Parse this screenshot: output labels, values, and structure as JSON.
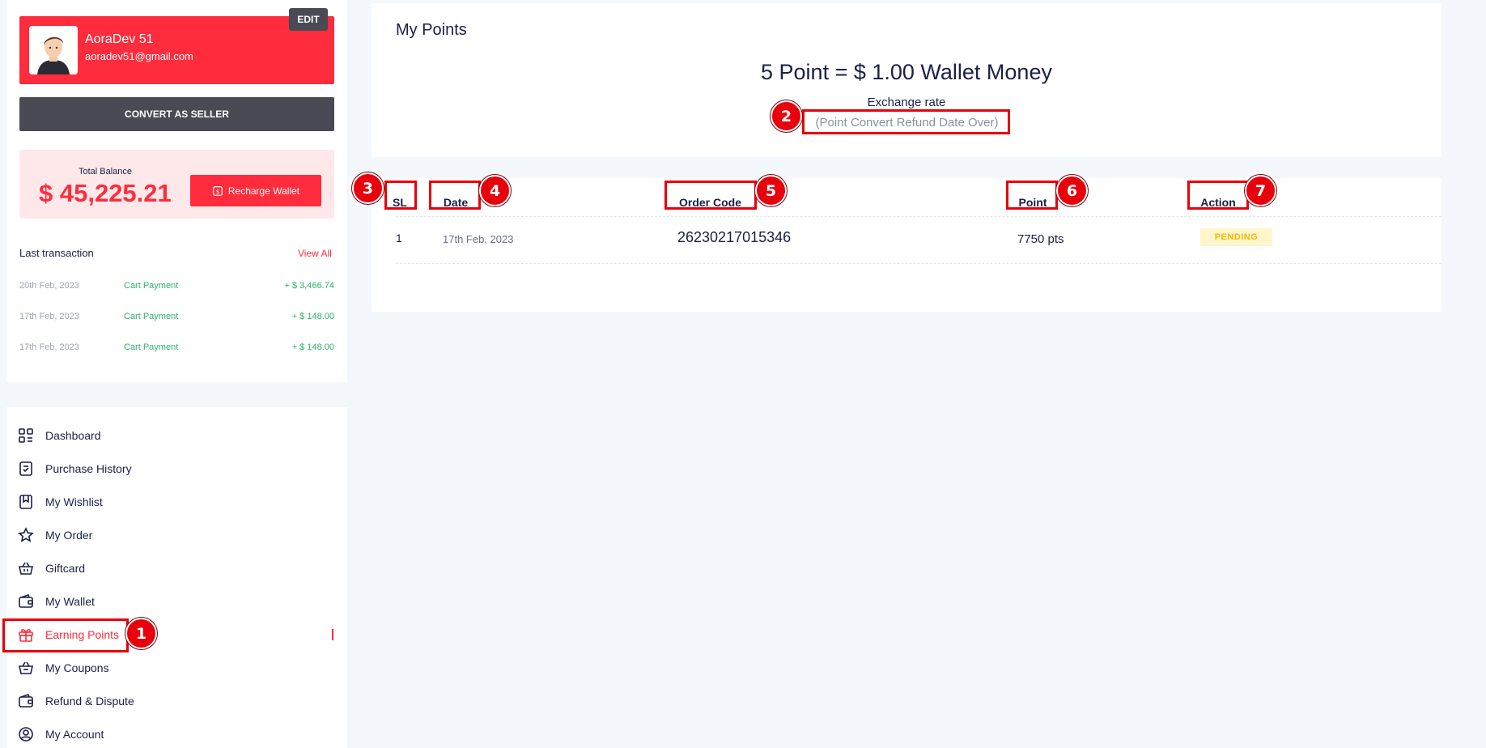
{
  "profile": {
    "name": "AoraDev 51",
    "email": "aoradev51@gmail.com",
    "edit_label": "EDIT"
  },
  "seller_button": "CONVERT AS SELLER",
  "balance": {
    "label": "Total Balance",
    "value": "$ 45,225.21",
    "recharge_label": "Recharge Wallet"
  },
  "last_transaction": {
    "title": "Last transaction",
    "view_all": "View All",
    "rows": [
      {
        "date": "20th Feb, 2023",
        "type": "Cart Payment",
        "amount": "+ $ 3,466.74"
      },
      {
        "date": "17th Feb, 2023",
        "type": "Cart Payment",
        "amount": "+ $ 148.00"
      },
      {
        "date": "17th Feb, 2023",
        "type": "Cart Payment",
        "amount": "+ $ 148.00"
      }
    ]
  },
  "menu": [
    {
      "label": "Dashboard",
      "icon": "dashboard-icon"
    },
    {
      "label": "Purchase History",
      "icon": "receipt-icon"
    },
    {
      "label": "My Wishlist",
      "icon": "bookmark-icon"
    },
    {
      "label": "My Order",
      "icon": "star-icon"
    },
    {
      "label": "Giftcard",
      "icon": "basket-icon"
    },
    {
      "label": "My Wallet",
      "icon": "wallet-icon"
    },
    {
      "label": "Earning Points",
      "icon": "gift-icon"
    },
    {
      "label": "My Coupons",
      "icon": "coupon-icon"
    },
    {
      "label": "Refund & Dispute",
      "icon": "wallet-icon"
    },
    {
      "label": "My Account",
      "icon": "user-circle-icon"
    }
  ],
  "points": {
    "title": "My Points",
    "rate": "5 Point = $ 1.00 Wallet Money",
    "rate_label": "Exchange rate",
    "rate_note": "(Point Convert Refund Date Over)"
  },
  "table": {
    "headers": [
      "SL",
      "Date",
      "Order Code",
      "Point",
      "Action"
    ],
    "rows": [
      {
        "sl": "1",
        "date": "17th Feb, 2023",
        "order_code": "26230217015346",
        "point": "7750 pts",
        "action": "PENDING"
      }
    ]
  },
  "annotations": [
    "1",
    "2",
    "3",
    "4",
    "5",
    "6",
    "7"
  ],
  "colors": {
    "accent": "#ff2c3d",
    "dark_button": "#4a4a55",
    "success": "#2bb36a",
    "pending": "#f5b800",
    "annotation": "#e8000c"
  }
}
